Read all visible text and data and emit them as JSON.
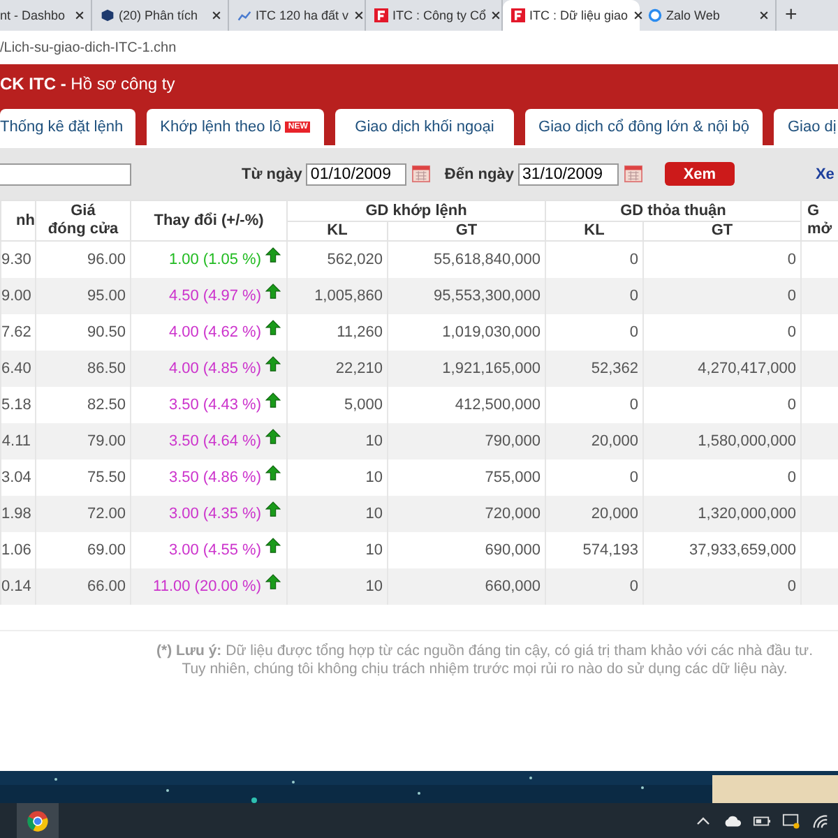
{
  "browser_tabs": [
    {
      "title": "nt - Dashbo",
      "selected": false
    },
    {
      "title": "(20) Phân tích",
      "selected": false
    },
    {
      "title": "ITC 120 ha đất v",
      "selected": false
    },
    {
      "title": "ITC : Công ty Cổ",
      "selected": false
    },
    {
      "title": "ITC : Dữ liệu giao",
      "selected": true
    },
    {
      "title": "Zalo Web",
      "selected": false
    }
  ],
  "new_tab": "+",
  "address": "/Lich-su-giao-dich-ITC-1.chn",
  "header": "**CK ITC -** Hồ sơ công ty",
  "page_tabs": [
    {
      "label": "Thống kê đặt lệnh"
    },
    {
      "label": "Khớp lệnh theo lô",
      "badge": "NEW"
    },
    {
      "label": "Giao dịch khối ngoại"
    },
    {
      "label": "Giao dịch cổ đông lớn & nội bộ"
    },
    {
      "label": "Giao dị"
    }
  ],
  "filter": {
    "from_label": "Từ ngày",
    "from": "01/10/2009",
    "to_label": "Đến ngày",
    "to": "31/10/2009",
    "button": "Xem",
    "link": "Xe"
  },
  "table": {
    "columns": {
      "column_1": "nh",
      "close": "Giá\nđóng cửa",
      "change": "Thay đổi (+/-%)",
      "matched": "GD khớp lệnh",
      "deal": "GD thỏa thuận",
      "column_8": "G\nmở",
      "matched_kl": "KL",
      "matched_gt": "GT",
      "deal_kl": "KL",
      "deal_gt": "GT"
    },
    "rows": [
      {
        "c1": "9.30",
        "close": "96.00",
        "change": "1.00 (1.05 %)",
        "color": "#22bb22",
        "m_kl": "562,020",
        "m_gt": "55,618,840,000",
        "d_kl": "0",
        "d_gt": "0"
      },
      {
        "c1": "9.00",
        "close": "95.00",
        "change": "4.50 (4.97 %)",
        "color": "#cc33cc",
        "m_kl": "1,005,860",
        "m_gt": "95,553,300,000",
        "d_kl": "0",
        "d_gt": "0"
      },
      {
        "c1": "7.62",
        "close": "90.50",
        "change": "4.00 (4.62 %)",
        "color": "#cc33cc",
        "m_kl": "11,260",
        "m_gt": "1,019,030,000",
        "d_kl": "0",
        "d_gt": "0"
      },
      {
        "c1": "6.40",
        "close": "86.50",
        "change": "4.00 (4.85 %)",
        "color": "#cc33cc",
        "m_kl": "22,210",
        "m_gt": "1,921,165,000",
        "d_kl": "52,362",
        "d_gt": "4,270,417,000"
      },
      {
        "c1": "5.18",
        "close": "82.50",
        "change": "3.50 (4.43 %)",
        "color": "#cc33cc",
        "m_kl": "5,000",
        "m_gt": "412,500,000",
        "d_kl": "0",
        "d_gt": "0"
      },
      {
        "c1": "4.11",
        "close": "79.00",
        "change": "3.50 (4.64 %)",
        "color": "#cc33cc",
        "m_kl": "10",
        "m_gt": "790,000",
        "d_kl": "20,000",
        "d_gt": "1,580,000,000"
      },
      {
        "c1": "3.04",
        "close": "75.50",
        "change": "3.50 (4.86 %)",
        "color": "#cc33cc",
        "m_kl": "10",
        "m_gt": "755,000",
        "d_kl": "0",
        "d_gt": "0"
      },
      {
        "c1": "1.98",
        "close": "72.00",
        "change": "3.00 (4.35 %)",
        "color": "#cc33cc",
        "m_kl": "10",
        "m_gt": "720,000",
        "d_kl": "20,000",
        "d_gt": "1,320,000,000"
      },
      {
        "c1": "1.06",
        "close": "69.00",
        "change": "3.00 (4.55 %)",
        "color": "#cc33cc",
        "m_kl": "10",
        "m_gt": "690,000",
        "d_kl": "574,193",
        "d_gt": "37,933,659,000"
      },
      {
        "c1": "0.14",
        "close": "66.00",
        "change": "11.00 (20.00 %)",
        "color": "#cc33cc",
        "m_kl": "10",
        "m_gt": "660,000",
        "d_kl": "0",
        "d_gt": "0"
      }
    ]
  },
  "note": "**(*) Lưu ý:** Dữ liệu được tổng hợp từ các nguồn đáng tin cậy, có giá trị tham khảo với các nhà đầu tư.\nTuy nhiên, chúng tôi không chịu trách nhiệm trước mọi rủi ro nào do sử dụng các dữ liệu này."
}
